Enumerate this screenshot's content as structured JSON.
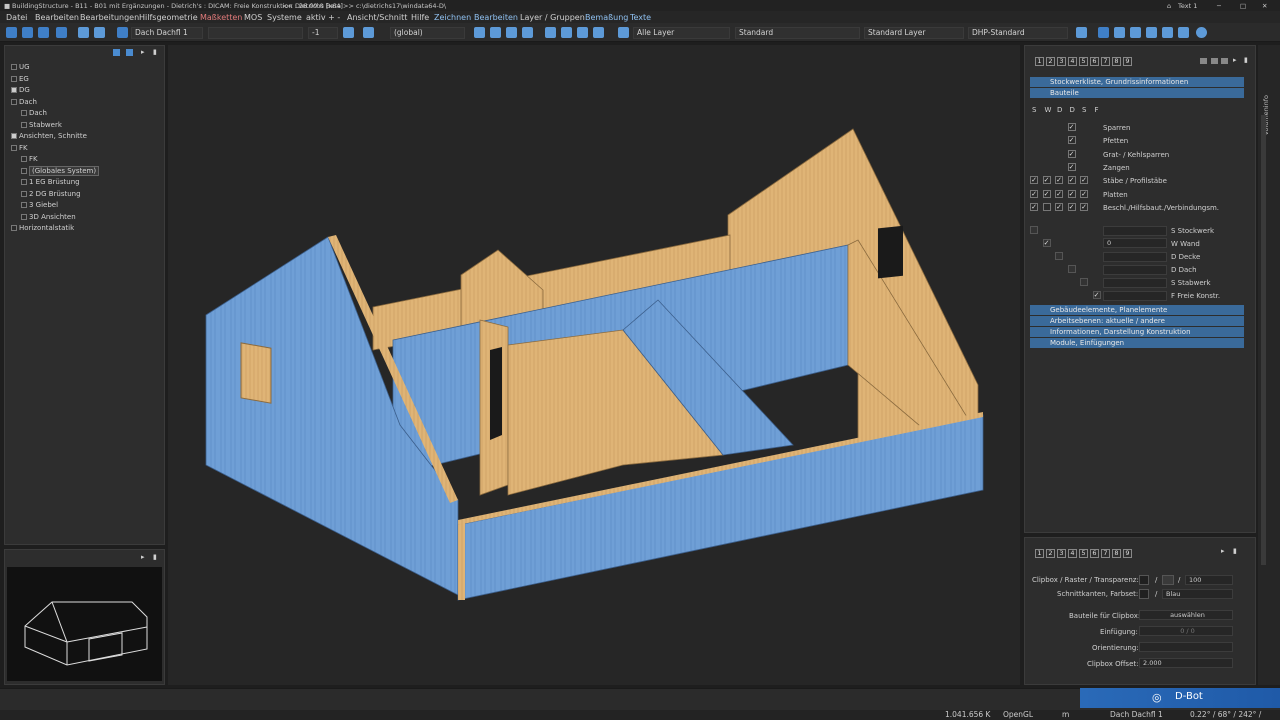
{
  "window": {
    "title": "BuildingStructure - B11 - B01 mit Ergänzungen - Dietrich's : DICAM: Freie Konstruktion : 26.09.0 [x64]",
    "subtitle": "<< Dietrichs Beta >> c:\\dietrichs17\\windata64-D\\",
    "user": "Text 1"
  },
  "menu": [
    "Datei",
    "Bearbeiten",
    "Bearbeitungen",
    "Hilfsgeometrie",
    "Maßketten",
    "MOS",
    "Systeme",
    "aktiv + -",
    "Ansicht/Schnitt",
    "Hilfe",
    "Zeichnen",
    "Bearbeiten",
    "Layer / Gruppen",
    "Bemaßung",
    "Texte"
  ],
  "toolbar": {
    "element": "Dach Dachfl 1",
    "level": "-1",
    "coord_system": "(global)",
    "layer": "Alle Layer",
    "style": "Standard",
    "layer_type": "Standard Layer",
    "pen": "DHP-Standard"
  },
  "tree": [
    {
      "label": "UG",
      "indent": 0
    },
    {
      "label": "EG",
      "indent": 0
    },
    {
      "label": "DG",
      "indent": 0
    },
    {
      "label": "Dach",
      "indent": 0
    },
    {
      "label": "Dach",
      "indent": 1
    },
    {
      "label": "Stabwerk",
      "indent": 1
    },
    {
      "label": "Ansichten, Schnitte",
      "indent": 0
    },
    {
      "label": "FK",
      "indent": 0
    },
    {
      "label": "FK",
      "indent": 1
    },
    {
      "label": "(Globales System)",
      "indent": 1
    },
    {
      "label": "1 EG Brüstung",
      "indent": 1
    },
    {
      "label": "2 DG Brüstung",
      "indent": 1
    },
    {
      "label": "3 Giebel",
      "indent": 1
    },
    {
      "label": "3D Ansichten",
      "indent": 1
    },
    {
      "label": "Horizontalstatik",
      "indent": 0
    }
  ],
  "panel": {
    "pages": [
      "1",
      "2",
      "3",
      "4",
      "5",
      "6",
      "7",
      "8",
      "9"
    ],
    "bars_top": [
      "Stockwerkliste, Grundrissinformationen",
      "Bauteile"
    ],
    "columns": [
      "S",
      "W",
      "D",
      "D",
      "S",
      "F"
    ],
    "components": [
      "Sparren",
      "Pfetten",
      "Grat- / Kehlsparren",
      "Zangen",
      "Stäbe / Profilstäbe",
      "Platten",
      "Beschl./Hilfsbaut./Verbindungsm."
    ],
    "layers": [
      "S Stockwerk",
      "W Wand",
      "D Decke",
      "D Dach",
      "S Stabwerk",
      "F Freie Konstr."
    ],
    "wand_value": "0",
    "bars_bottom": [
      "Gebäudeelemente, Planelemente",
      "Arbeitsebenen: aktuelle / andere",
      "Informationen, Darstellung Konstruktion",
      "Module, Einfügungen"
    ]
  },
  "clip": {
    "raster_label": "Clipbox / Raster / Transparenz:",
    "raster_value": "100",
    "schnitt_label": "Schnittkanten, Farbset:",
    "schnitt_value": "Blau",
    "bauteile_label": "Bauteile für Clipbox:",
    "bauteile_button": "auswählen",
    "einfuegung_label": "Einfügung:",
    "einfuegung_value": "0 / 0",
    "orientierung_label": "Orientierung:",
    "offset_label": "Clipbox Offset:",
    "offset_value": "2.000"
  },
  "side_tab": "Volumeninfo",
  "dbot": "D-Bot",
  "status": {
    "count": "1.041.656 K",
    "renderer": "OpenGL",
    "unit": "m",
    "element": "Dach Dachfl 1",
    "angles": "0.22° / 68° / 242° /"
  },
  "colors": {
    "accent": "#3f7fc7",
    "panel_bar": "#3a6a9a",
    "wall_blue": "#6fa0d6",
    "wood": "#e0b77a"
  }
}
